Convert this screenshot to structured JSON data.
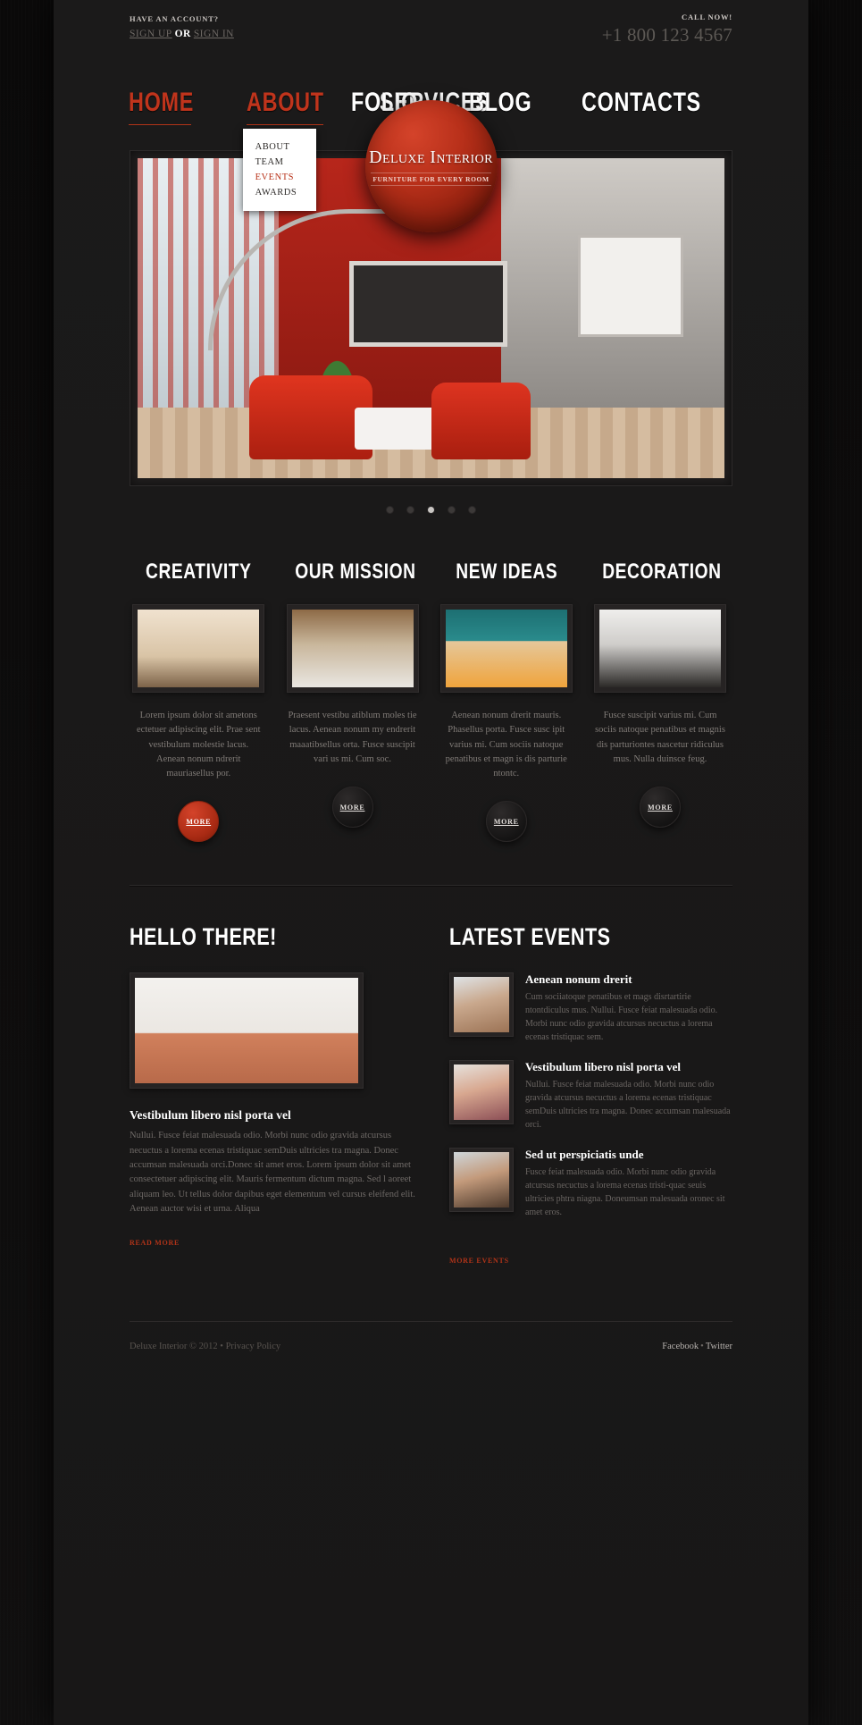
{
  "topbar": {
    "account_label": "HAVE AN ACCOUNT?",
    "sign_up": "SIGN UP",
    "or": "OR",
    "sign_in": "SIGN IN",
    "call_label": "CALL NOW!",
    "phone": "+1 800 123 4567"
  },
  "logo": {
    "name": "Deluxe Interior",
    "tagline": "FURNITURE FOR EVERY ROOM"
  },
  "nav": {
    "left": [
      {
        "label": "HOME",
        "active": true
      },
      {
        "label": "ABOUT",
        "active": true
      },
      {
        "label": "SERVICES",
        "active": false
      }
    ],
    "right": [
      {
        "label": "FOLIO",
        "active": false
      },
      {
        "label": "BLOG",
        "active": false
      },
      {
        "label": "CONTACTS",
        "active": false
      }
    ],
    "dropdown": [
      {
        "label": "ABOUT",
        "highlight": false
      },
      {
        "label": "TEAM",
        "highlight": false
      },
      {
        "label": "EVENTS",
        "highlight": true
      },
      {
        "label": "AWARDS",
        "highlight": false
      }
    ]
  },
  "slider": {
    "image_name": "red-interior-living-room",
    "dots": [
      false,
      false,
      true,
      false,
      false
    ],
    "active_index": 2
  },
  "services": [
    {
      "title": "CREATIVITY",
      "image_name": "beige-sofa-thumbnail",
      "text": "Lorem ipsum dolor sit ametons ectetuer adipiscing elit. Prae sent vestibulum molestie lacus. Aenean nonum ndrerit mauriasellus por.",
      "more_label": "MORE",
      "more_active": true
    },
    {
      "title": "OUR MISSION",
      "image_name": "attic-room-thumbnail",
      "text": "Praesent vestibu atiblum moles tie lacus. Aenean nonum my endrerit maaatibsellus orta. Fusce suscipit vari us mi. Cum soc.",
      "more_label": "MORE",
      "more_active": false
    },
    {
      "title": "NEW IDEAS",
      "image_name": "orange-cushions-thumbnail",
      "text": "Aenean nonum drerit mauris. Phasellus porta. Fusce susc ipit varius mi. Cum sociis natoque penatibus et magn is dis parturie ntontc.",
      "more_label": "MORE",
      "more_active": false
    },
    {
      "title": "DECORATION",
      "image_name": "black-white-pillows-thumbnail",
      "text": "Fusce suscipit varius mi. Cum sociis natoque penatibus et magnis dis parturiontes nascetur ridiculus mus. Nulla duinsce feug.",
      "more_label": "MORE",
      "more_active": false
    }
  ],
  "hello": {
    "title": "HELLO THERE!",
    "image_name": "orange-sofa-living-room",
    "heading": "Vestibulum libero nisl porta vel",
    "body": "Nullui. Fusce feiat malesuada odio. Morbi nunc odio gravida atcursus necuctus a lorema ecenas tristiquac semDuis ultricies tra magna. Donec accumsan malesuada orci.Donec sit amet eros. Lorem ipsum dolor sit amet consectetuer adipiscing elit. Mauris fermentum dictum magna. Sed l aoreet aliquam leo. Ut tellus dolor dapibus eget elementum vel cursus eleifend elit. Aenean auctor wisi et urna. Aliqua",
    "read_more": "READ MORE"
  },
  "events": {
    "title": "LATEST EVENTS",
    "items": [
      {
        "image_name": "man-smiling-portrait",
        "heading": "Aenean nonum drerit",
        "text": "Cum sociiatoque penatibus et mags disrtartirie ntontdiculus mus. Nullui. Fusce feiat malesuada odio. Morbi nunc odio gravida atcursus necuctus a lorema ecenas tristiquac sem."
      },
      {
        "image_name": "woman-smiling-portrait",
        "heading": "Vestibulum libero nisl porta vel",
        "text": "Nullui. Fusce feiat malesuada odio. Morbi nunc odio gravida atcursus necuctus a lorema ecenas tristiquac semDuis ultricies tra magna. Donec accumsan malesuada orci."
      },
      {
        "image_name": "man-thinking-portrait",
        "heading": "Sed ut perspiciatis unde",
        "text": "Fusce feiat malesuada odio. Morbi nunc odio gravida atcursus necuctus a lorema ecenas tristi-quac seuis ultricies phtra niagna. Doneumsan malesuada oronec sit amet eros."
      }
    ],
    "more_events": "MORE EVENTS"
  },
  "footer": {
    "copyright": "Deluxe Interior © 2012 •",
    "privacy": "Privacy Policy",
    "facebook": "Facebook",
    "separator": "•",
    "twitter": "Twitter"
  },
  "colors": {
    "accent": "#b03318",
    "logo_red": "#b8301a",
    "page_bg": "#1a1919",
    "text_muted": "#6f6a67"
  }
}
